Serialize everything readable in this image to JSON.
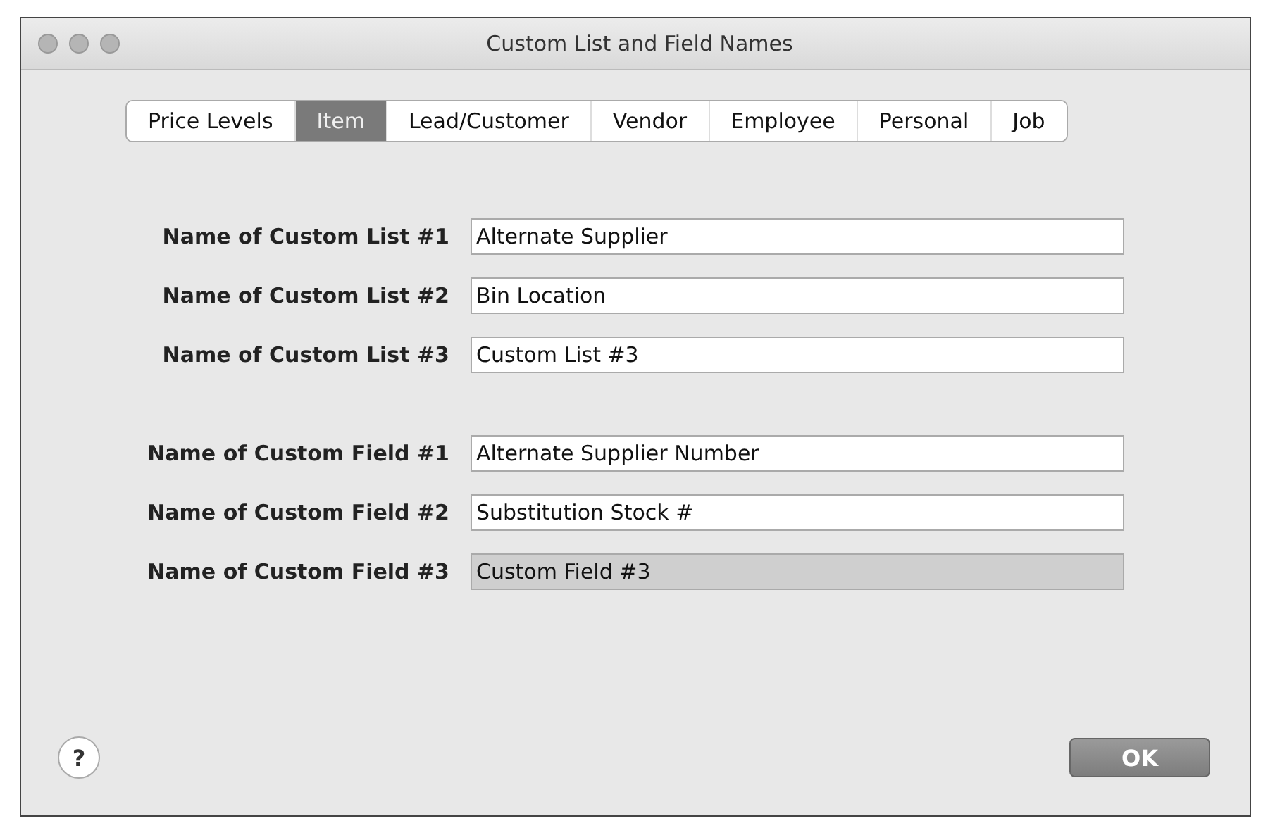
{
  "window": {
    "title": "Custom List and Field Names"
  },
  "tabs": [
    {
      "label": "Price Levels",
      "selected": false
    },
    {
      "label": "Item",
      "selected": true
    },
    {
      "label": "Lead/Customer",
      "selected": false
    },
    {
      "label": "Vendor",
      "selected": false
    },
    {
      "label": "Employee",
      "selected": false
    },
    {
      "label": "Personal",
      "selected": false
    },
    {
      "label": "Job",
      "selected": false
    }
  ],
  "list_fields": [
    {
      "label": "Name of Custom List #1",
      "value": "Alternate Supplier",
      "highlighted": false
    },
    {
      "label": "Name of Custom List #2",
      "value": "Bin Location",
      "highlighted": false
    },
    {
      "label": "Name of Custom List #3",
      "value": "Custom List #3",
      "highlighted": false
    }
  ],
  "custom_fields": [
    {
      "label": "Name of Custom Field #1",
      "value": "Alternate Supplier Number",
      "highlighted": false
    },
    {
      "label": "Name of Custom Field #2",
      "value": "Substitution Stock #",
      "highlighted": false
    },
    {
      "label": "Name of Custom Field #3",
      "value": "Custom Field #3",
      "highlighted": true
    }
  ],
  "help_button": "?",
  "ok_button": "OK"
}
